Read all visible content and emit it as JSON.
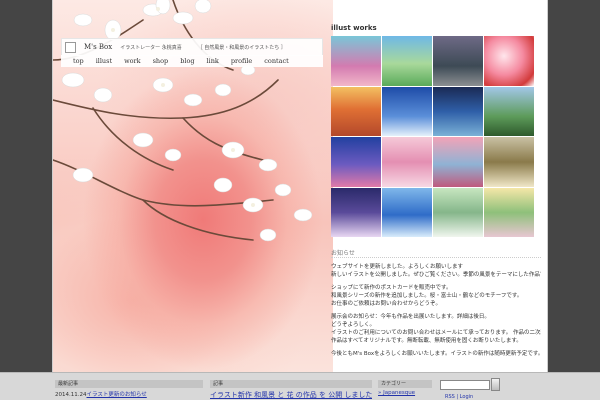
{
  "header": {
    "site_name": "M's Box",
    "tagline": "イラストレーター 永桃真喜",
    "catch": "［ 自然風景・和風景のイラストたち ］"
  },
  "nav": [
    {
      "label": "top"
    },
    {
      "label": "illust"
    },
    {
      "label": "work"
    },
    {
      "label": "shop"
    },
    {
      "label": "blog"
    },
    {
      "label": "link"
    },
    {
      "label": "profile"
    },
    {
      "label": "contact"
    }
  ],
  "works": {
    "title": "illust works",
    "thumbs": [
      {
        "bg": "linear-gradient(180deg,#7ac6d8 0%,#d37bb0 60%,#f2b7c9 100%)"
      },
      {
        "bg": "linear-gradient(180deg,#6fb8e6 0%,#a9d99b 55%,#5aaa5a 100%)"
      },
      {
        "bg": "linear-gradient(180deg,#6e6a86 0%,#3d4a55 60%,#8b8f92 100%)"
      },
      {
        "bg": "radial-gradient(circle at 40% 40%,#ffe6ec 0%,#f58aa0 45%,#d23a3a 80%,#ffffff 100%)"
      },
      {
        "bg": "linear-gradient(180deg,#f3c062 0%,#e07034 45%,#b3482b 100%)"
      },
      {
        "bg": "linear-gradient(180deg,#1e4ca8 0%,#5b8fd9 60%,#e5f0fb 100%)"
      },
      {
        "bg": "linear-gradient(180deg,#1a2a55 0%,#2f5fa8 50%,#7bb1d6 100%)"
      },
      {
        "bg": "linear-gradient(180deg,#a2c7e8 0%,#5d9b5a 60%,#2e5a2c 100%)"
      },
      {
        "bg": "linear-gradient(180deg,#2240a0 0%,#6c5bc0 55%,#e07aa8 100%)"
      },
      {
        "bg": "linear-gradient(180deg,#f5c9d8 0%,#e48fb2 50%,#f7d8e4 100%)"
      },
      {
        "bg": "linear-gradient(180deg,#f2a3b7 0%,#8fb2d4 55%,#c05a7d 100%)"
      },
      {
        "bg": "linear-gradient(180deg,#c9c1a4 0%,#8a7a4a 50%,#f0e7c8 100%)"
      },
      {
        "bg": "linear-gradient(180deg,#2a2a6a 0%,#5a4a9a 50%,#e8d7f2 100%)"
      },
      {
        "bg": "linear-gradient(180deg,#7fb7ea 0%,#2f6cc8 55%,#d9ecfb 100%)"
      },
      {
        "bg": "linear-gradient(180deg,#c7e6c0 0%,#85b68a 50%,#f0f6ee 100%)"
      },
      {
        "bg": "linear-gradient(180deg,#f5e7a8 0%,#8ec07a 50%,#e8c7d2 100%)"
      }
    ]
  },
  "news": {
    "title": "お知らせ",
    "lines": [
      "ウェブサイトを更新しました。よろしくお願いします",
      "新しいイラストを公開しました。ぜひご覧ください。季節の風景をテーマにした作品です。",
      "",
      "ショップにて新作のポストカードを販売中です。",
      "和風景シリーズの新作を追加しました。桜・富士山・鶴などのモチーフです。",
      "お仕事のご依頼はお問い合わせからどうぞ。",
      "",
      "展示会のお知らせ：今年も作品を出展いたします。詳細は後日。",
      "どうぞよろしく。",
      "イラストのご利用についてのお問い合わせはメールにて承っております。 作品の二次利用、転載はご遠慮ください。 ありがとうございます。",
      "作品はすべてオリジナルです。無断転載、無断使用を固くお断りいたします。",
      "",
      "今後ともM's Boxをよろしくお願いいたします。イラストの新作は随時更新予定です。"
    ]
  },
  "footer": {
    "col1_head": "最新記事",
    "col1_date": "2014.11.24",
    "col1_link": "イラスト更新のお知らせ",
    "col2_head": "記事",
    "col2_link": "イラスト新作 和風景 と 花 の作品 を 公開 しました の お知らせ です",
    "col3_head": "カテゴリー",
    "col3_link": "» Japanesque",
    "rss": "RSS | Login"
  },
  "colors": {
    "background": "#3a3a3a",
    "page": "#ffffff",
    "footer": "#d8d8d8",
    "link": "#2233aa"
  }
}
